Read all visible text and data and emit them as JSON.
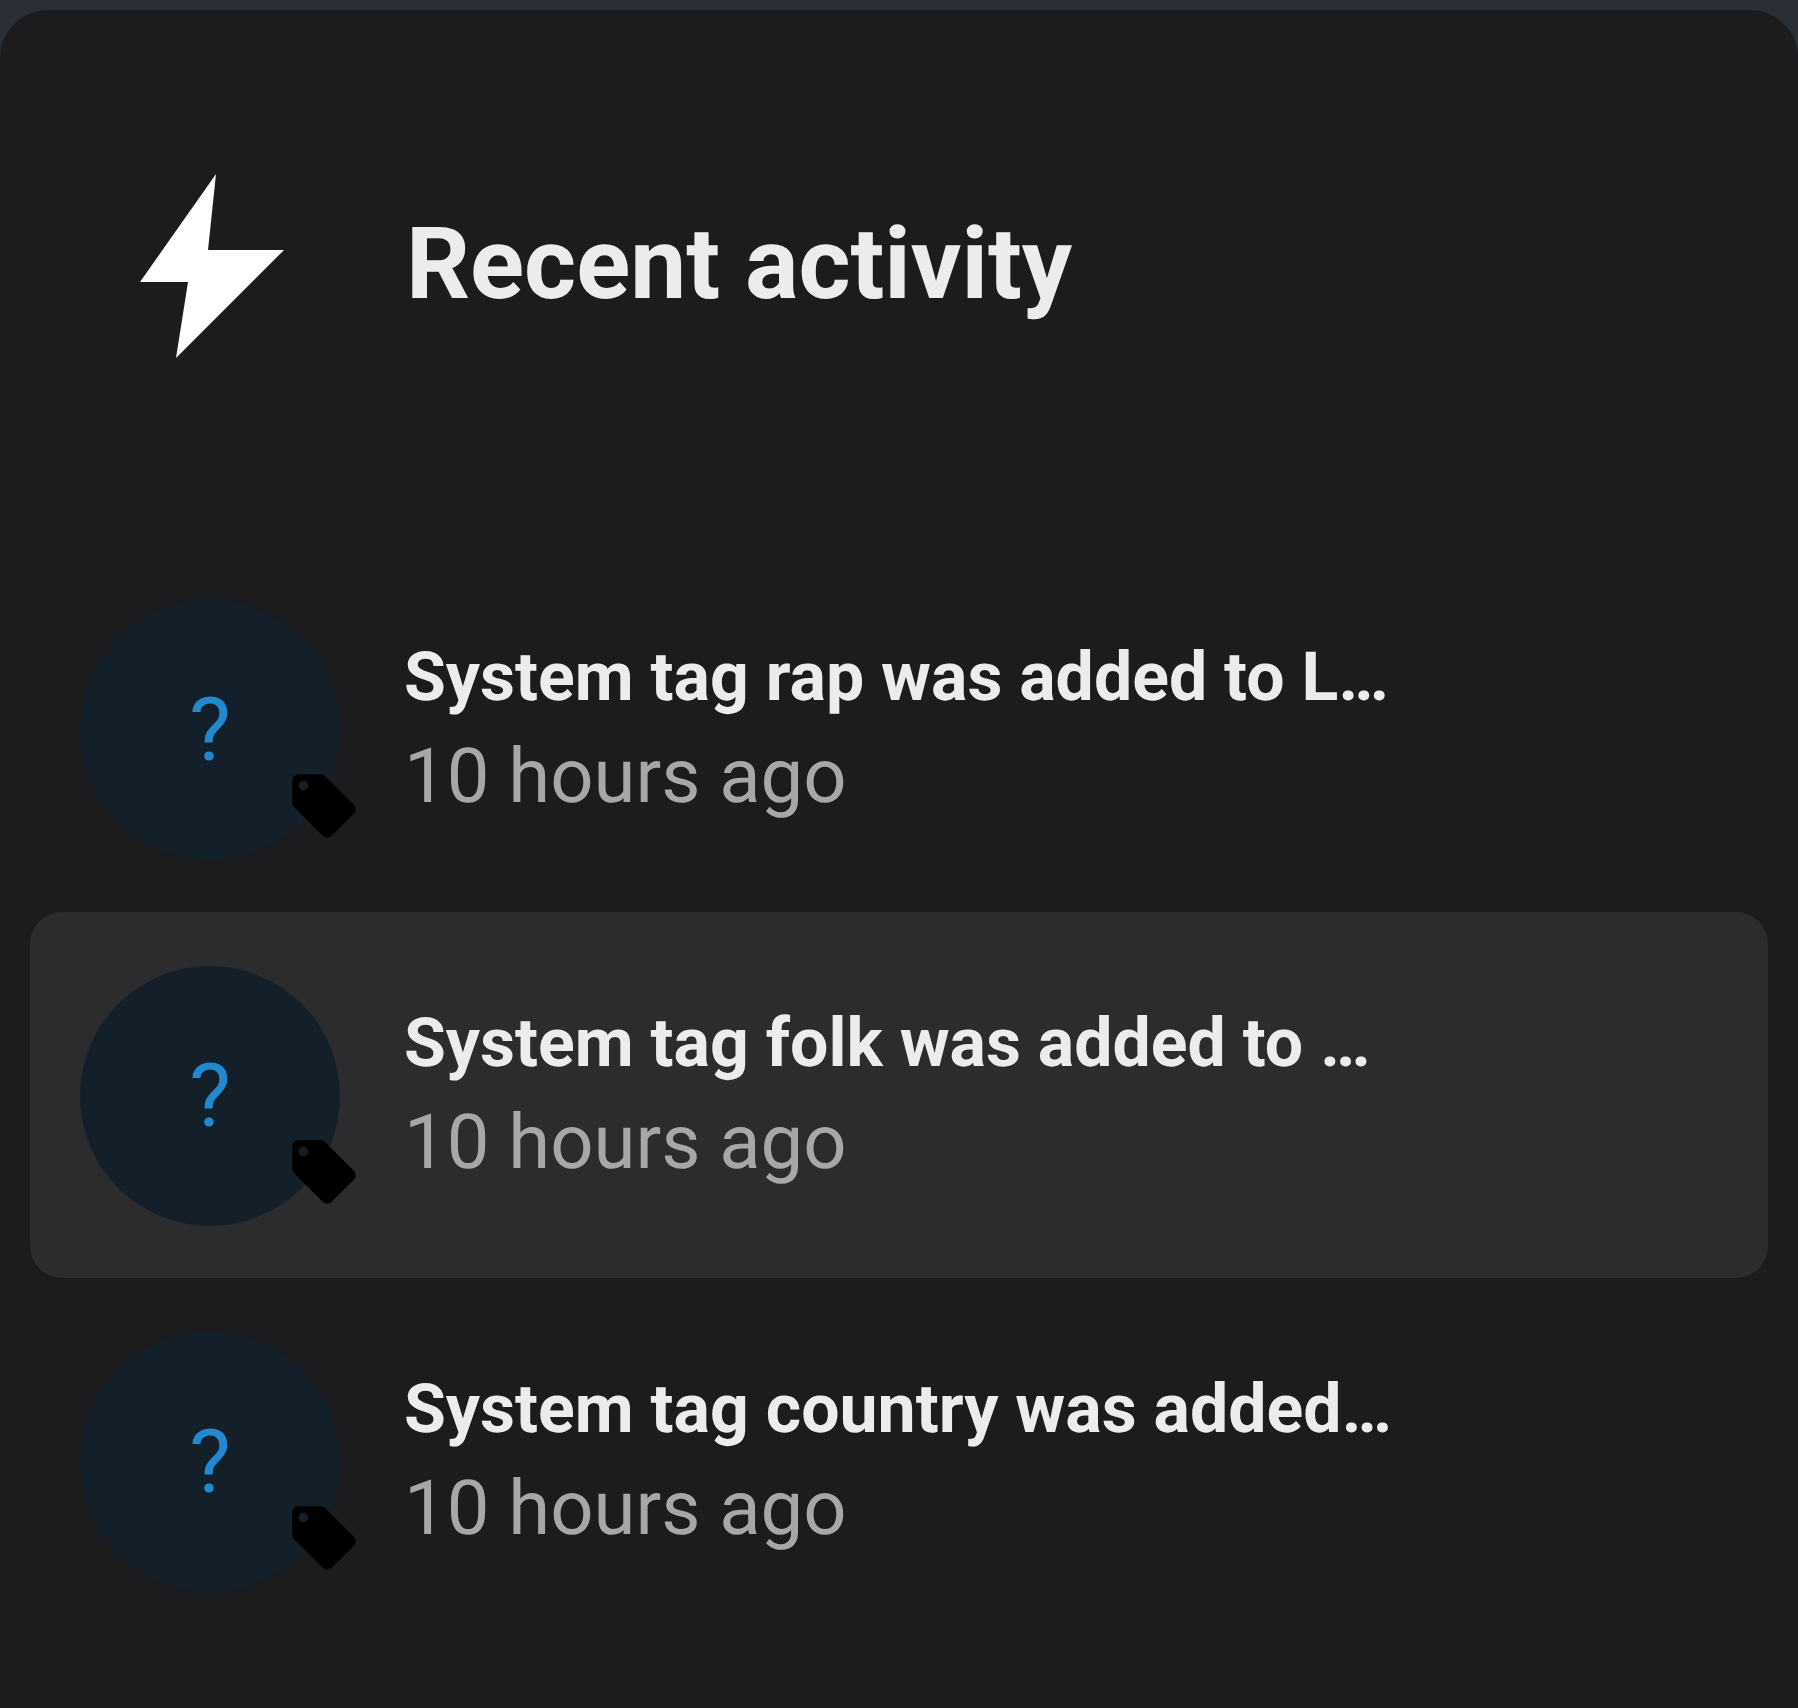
{
  "header": {
    "title": "Recent activity"
  },
  "activities": [
    {
      "avatar": "?",
      "title": "System tag rap was added to L…",
      "time": "10 hours ago",
      "selected": false
    },
    {
      "avatar": "?",
      "title": "System tag folk was added to …",
      "time": "10 hours ago",
      "selected": true
    },
    {
      "avatar": "?",
      "title": "System tag country was added…",
      "time": "10 hours ago",
      "selected": false
    }
  ]
}
